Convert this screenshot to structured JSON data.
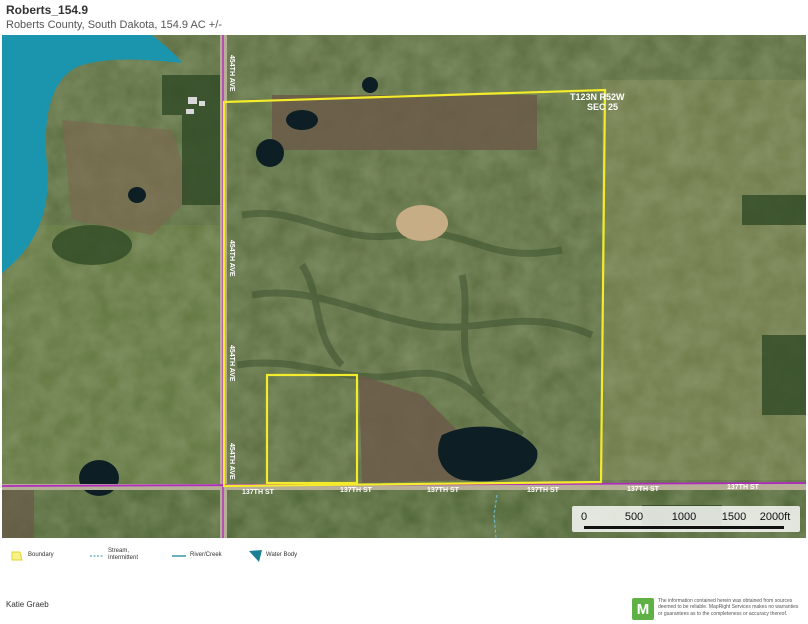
{
  "header": {
    "title": "Roberts_154.9",
    "subtitle": "Roberts County, South Dakota, 154.9 AC +/-"
  },
  "map": {
    "township_label": "T123N R52W",
    "section_label": "SEC 25",
    "road_vertical": "454TH AVE",
    "road_horizontal": "137TH ST",
    "colors": {
      "boundary": "#f4ec2a",
      "road_line": "#b02bbd",
      "water": "#0e7f9a",
      "lake": "#1a95ad"
    }
  },
  "scale_bar": {
    "labels": [
      "0",
      "500",
      "1000",
      "1500",
      "2000ft"
    ]
  },
  "legend": {
    "items": [
      {
        "label": "Boundary",
        "icon": "boundary-icon"
      },
      {
        "label": "Stream, Intermittent",
        "icon": "stream-intermittent-icon"
      },
      {
        "label": "River/Creek",
        "icon": "river-creek-icon"
      },
      {
        "label": "Water Body",
        "icon": "water-body-icon"
      }
    ]
  },
  "footer": {
    "author": "Katie Graeb",
    "logo_letter": "M",
    "disclaimer": "The information contained herein was obtained from sources deemed to be reliable. MapRight Services makes no warranties or guarantees as to the completeness or accuracy thereof."
  }
}
